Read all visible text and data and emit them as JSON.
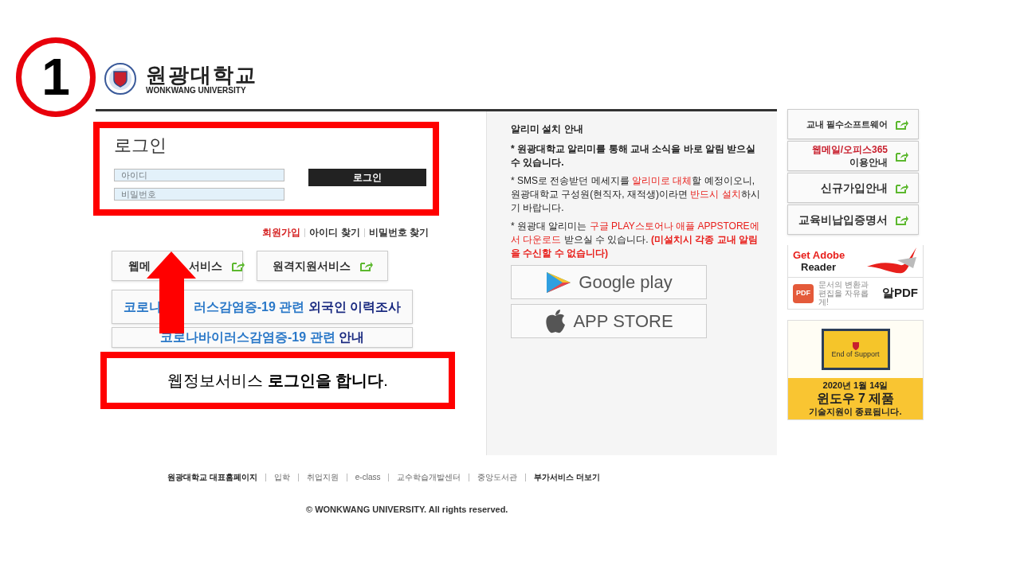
{
  "step_badge": "1",
  "header": {
    "logo_korean": "원광대학교",
    "logo_english": "WONKWANG UNIVERSITY"
  },
  "login": {
    "title": "로그인",
    "fields": [
      {
        "placeholder": "아이디"
      },
      {
        "placeholder": "비밀번호"
      }
    ],
    "button": "로그인"
  },
  "account_links": [
    {
      "label": "회원가입",
      "highlight": true
    },
    {
      "label": "아이디 찾기",
      "highlight": false
    },
    {
      "label": "비밀번호 찾기",
      "highlight": false
    }
  ],
  "service_buttons": [
    {
      "parts": [
        "웹메",
        "서비스"
      ]
    },
    {
      "parts": [
        "원격지원서비스"
      ]
    }
  ],
  "notice_buttons": [
    {
      "lead": "코로나",
      "segments": [
        {
          "text": "러스감염증-19 관련 ",
          "strong": false
        },
        {
          "text": "외국인 이력조사",
          "strong": true
        }
      ]
    },
    {
      "segments": [
        {
          "text": "코로나바이러스감염증-19 관련 ",
          "strong": false
        },
        {
          "text": "안내",
          "strong": true
        }
      ]
    }
  ],
  "alimi": {
    "title": "알리미 설치 안내",
    "paragraphs": [
      [
        {
          "text": "* 원광대학교 알리미를 통해 교내 소식을 바로 알림 받으실 수 있습니다.",
          "highlight": false,
          "bold": true
        }
      ],
      [
        {
          "text": "* SMS로 전송받던 메세지를 ",
          "highlight": false,
          "bold": false
        },
        {
          "text": "알리미로 대체",
          "highlight": true,
          "bold": false
        },
        {
          "text": "할 예정이오니, 원광대학교 구성원(현직자, 재적생)이라면 ",
          "highlight": false,
          "bold": false
        },
        {
          "text": "반드시 설치",
          "highlight": true,
          "bold": false
        },
        {
          "text": "하시기 바랍니다.",
          "highlight": false,
          "bold": false
        }
      ],
      [
        {
          "text": "* 원광대 알리미는 ",
          "highlight": false,
          "bold": false
        },
        {
          "text": "구글 PLAY스토어나 애플 APPSTORE에서 다운로드",
          "highlight": true,
          "bold": false
        },
        {
          "text": " 받으실 수 있습니다. ",
          "highlight": false,
          "bold": false
        },
        {
          "text": "(미설치시 각종 교내 알림을 수신할 수 없습니다)",
          "highlight": true,
          "bold": true
        }
      ]
    ],
    "stores": [
      {
        "kind": "google",
        "label": "Google play"
      },
      {
        "kind": "apple",
        "label": "APP STORE"
      }
    ]
  },
  "side_links": [
    {
      "lines": [
        {
          "text": "교내 필수소프트웨어",
          "highlight": false
        }
      ]
    },
    {
      "lines": [
        {
          "text": "웹메일/오피스365",
          "highlight": true
        },
        {
          "text": "이용안내",
          "highlight": false
        }
      ]
    },
    {
      "lines": [
        {
          "text": "신규가입안내",
          "highlight": false
        }
      ]
    },
    {
      "lines": [
        {
          "text": "교육비납입증명서",
          "highlight": false
        }
      ]
    }
  ],
  "adobe_banner": {
    "title": "Get Adobe",
    "subtitle": "Reader"
  },
  "alpdf_banner": {
    "tagline": "문서의 변환과 편집을 자유롭게!",
    "name": "알PDF",
    "icon_label": "PDF"
  },
  "windows_banner": {
    "screen_label": "End of Support",
    "date": "2020년 1월 14일",
    "headline": "윈도우 7 제품",
    "footer": "기술지원이 종료됩니다."
  },
  "footer_links": [
    {
      "label": "원광대학교 대표홈페이지",
      "bold": true
    },
    {
      "label": "입학",
      "bold": false
    },
    {
      "label": "취업지원",
      "bold": false
    },
    {
      "label": "e-class",
      "bold": false
    },
    {
      "label": "교수학습개발센터",
      "bold": false
    },
    {
      "label": "중앙도서관",
      "bold": false
    },
    {
      "label": "부가서비스 더보기",
      "bold": true
    }
  ],
  "copyright": "© WONKWANG UNIVERSITY. All rights reserved.",
  "callout": "웹정보서비스 **로그인을 합니다**."
}
